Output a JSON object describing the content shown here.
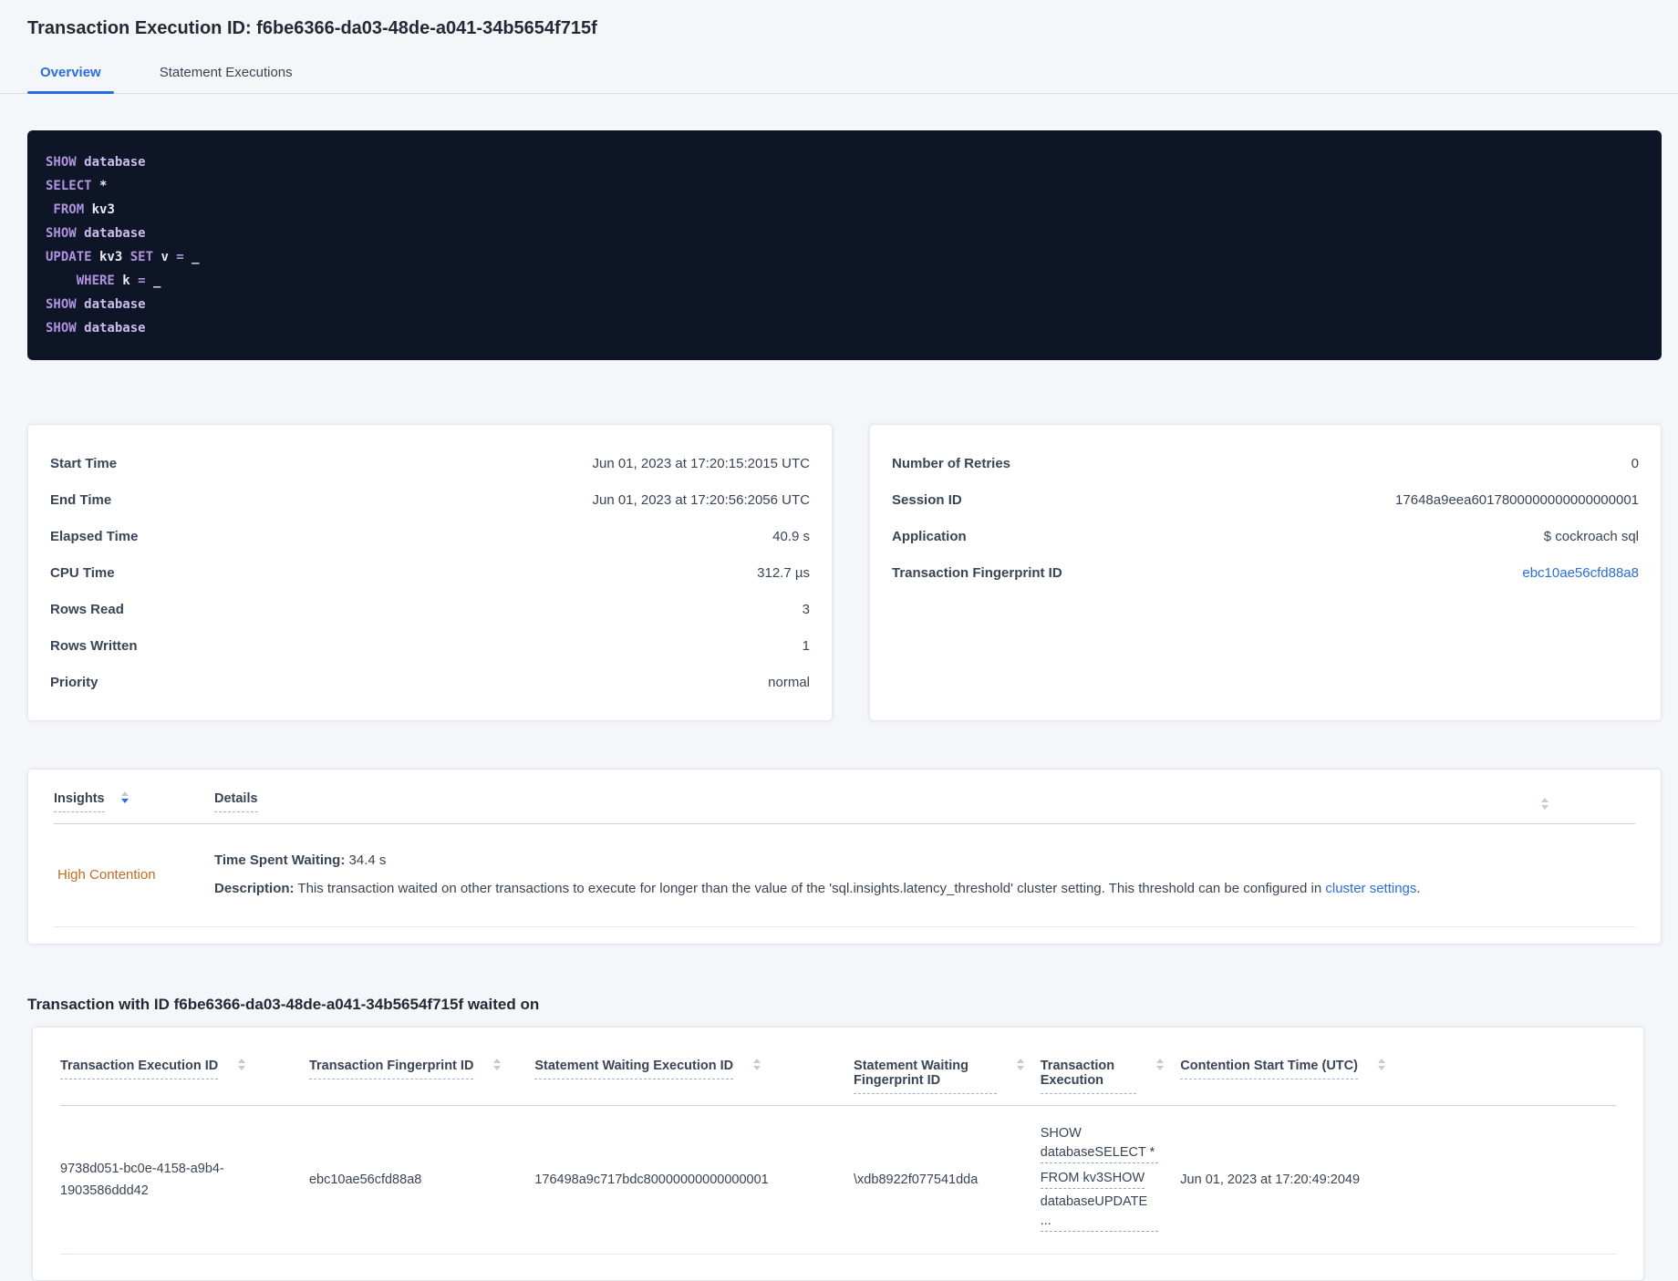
{
  "colors": {
    "accent_blue": "#2a6ddf",
    "warning_orange": "#c26b22",
    "code_background": "#0e1526",
    "code_keyword": "#b194e0",
    "code_identifier": "#eceaf6"
  },
  "header": {
    "title": "Transaction Execution ID: f6be6366-da03-48de-a041-34b5654f715f"
  },
  "tabs": [
    {
      "label": "Overview"
    },
    {
      "label": "Statement Executions"
    }
  ],
  "sql_box": {
    "lines": [
      [
        [
          "kw",
          "SHOW"
        ],
        [
          "db",
          " database"
        ]
      ],
      [
        [
          "kw",
          "SELECT"
        ],
        [
          "id",
          " *"
        ]
      ],
      [
        [
          "kw",
          " FROM"
        ],
        [
          "id",
          " kv3"
        ]
      ],
      [
        [
          "kw",
          "SHOW"
        ],
        [
          "db",
          " database"
        ]
      ],
      [
        [
          "kw",
          "UPDATE"
        ],
        [
          "id",
          " kv3"
        ],
        [
          "kw",
          " SET"
        ],
        [
          "id",
          " v"
        ],
        [
          "kw",
          " ="
        ],
        [
          "id",
          " _"
        ]
      ],
      [
        [
          "kw",
          "    WHERE"
        ],
        [
          "id",
          " k"
        ],
        [
          "kw",
          " ="
        ],
        [
          "id",
          " _"
        ]
      ],
      [
        [
          "kw",
          "SHOW"
        ],
        [
          "db",
          " database"
        ]
      ],
      [
        [
          "kw",
          "SHOW"
        ],
        [
          "db",
          " database"
        ]
      ]
    ]
  },
  "summary_left": {
    "rows": [
      {
        "label": "Start Time",
        "value": "Jun 01, 2023 at 17:20:15:2015 UTC"
      },
      {
        "label": "End Time",
        "value": "Jun 01, 2023 at 17:20:56:2056 UTC"
      },
      {
        "label": "Elapsed Time",
        "value": "40.9 s"
      },
      {
        "label": "CPU Time",
        "value": "312.7 µs"
      },
      {
        "label": "Rows Read",
        "value": "3"
      },
      {
        "label": "Rows Written",
        "value": "1"
      },
      {
        "label": "Priority",
        "value": "normal"
      }
    ]
  },
  "summary_right": {
    "rows": [
      {
        "label": "Number of Retries",
        "value": "0"
      },
      {
        "label": "Session ID",
        "value": "17648a9eea6017800000000000000001"
      },
      {
        "label": "Application",
        "value": "$ cockroach sql"
      },
      {
        "label": "Transaction Fingerprint ID",
        "value": "ebc10ae56cfd88a8"
      }
    ]
  },
  "insights_table": {
    "col_insights": "Insights",
    "col_details": "Details",
    "row": {
      "insight": "High Contention",
      "time_label": "Time Spent Waiting:",
      "time_value": " 34.4 s",
      "desc_label": "Description:",
      "desc_text": " This transaction waited on other transactions to execute for longer than the value of the 'sql.insights.latency_threshold' cluster setting. This threshold can be configured in ",
      "desc_link": "cluster settings",
      "desc_end": "."
    }
  },
  "waited_on": {
    "heading": "Transaction with ID f6be6366-da03-48de-a041-34b5654f715f waited on",
    "columns": [
      "Transaction Execution ID",
      "Transaction Fingerprint ID",
      "Statement Waiting Execution ID",
      "Statement Waiting Fingerprint ID",
      "Transaction Execution",
      "Contention Start Time (UTC)"
    ],
    "row": {
      "transaction_execution_id": "9738d051-bc0e-4158-a9b4-1903586ddd42",
      "transaction_fingerprint_id": "ebc10ae56cfd88a8",
      "statement_waiting_execution_id": "176498a9c717bdc80000000000000001",
      "statement_waiting_fingerprint_id": "\\xdb8922f077541dda",
      "transaction_execution": [
        "SHOW databaseSELECT *",
        "FROM kv3SHOW",
        "databaseUPDATE ..."
      ],
      "contention_start_time": "Jun 01, 2023 at 17:20:49:2049"
    }
  }
}
